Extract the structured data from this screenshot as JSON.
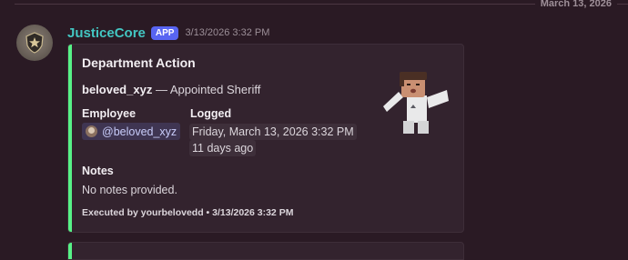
{
  "date_divider": "March 13, 2026",
  "message": {
    "author": "JusticeCore",
    "app_tag": "APP",
    "timestamp": "3/13/2026 3:32 PM"
  },
  "embed": {
    "accent_color": "#57f287",
    "title": "Department Action",
    "description_user": "beloved_xyz",
    "description_action": " — Appointed Sheriff",
    "fields": {
      "employee_label": "Employee",
      "employee_value": "@beloved_xyz",
      "logged_label": "Logged",
      "logged_value": "Friday, March 13, 2026 3:32 PM",
      "logged_relative": "11 days ago",
      "notes_label": "Notes",
      "notes_value": "No notes provided."
    },
    "footer": "Executed by yourbelovedd • 3/13/2026 3:32 PM"
  },
  "icons": {
    "author_avatar": "sheriff-badge-icon",
    "thumbnail": "roblox-avatar-image"
  }
}
